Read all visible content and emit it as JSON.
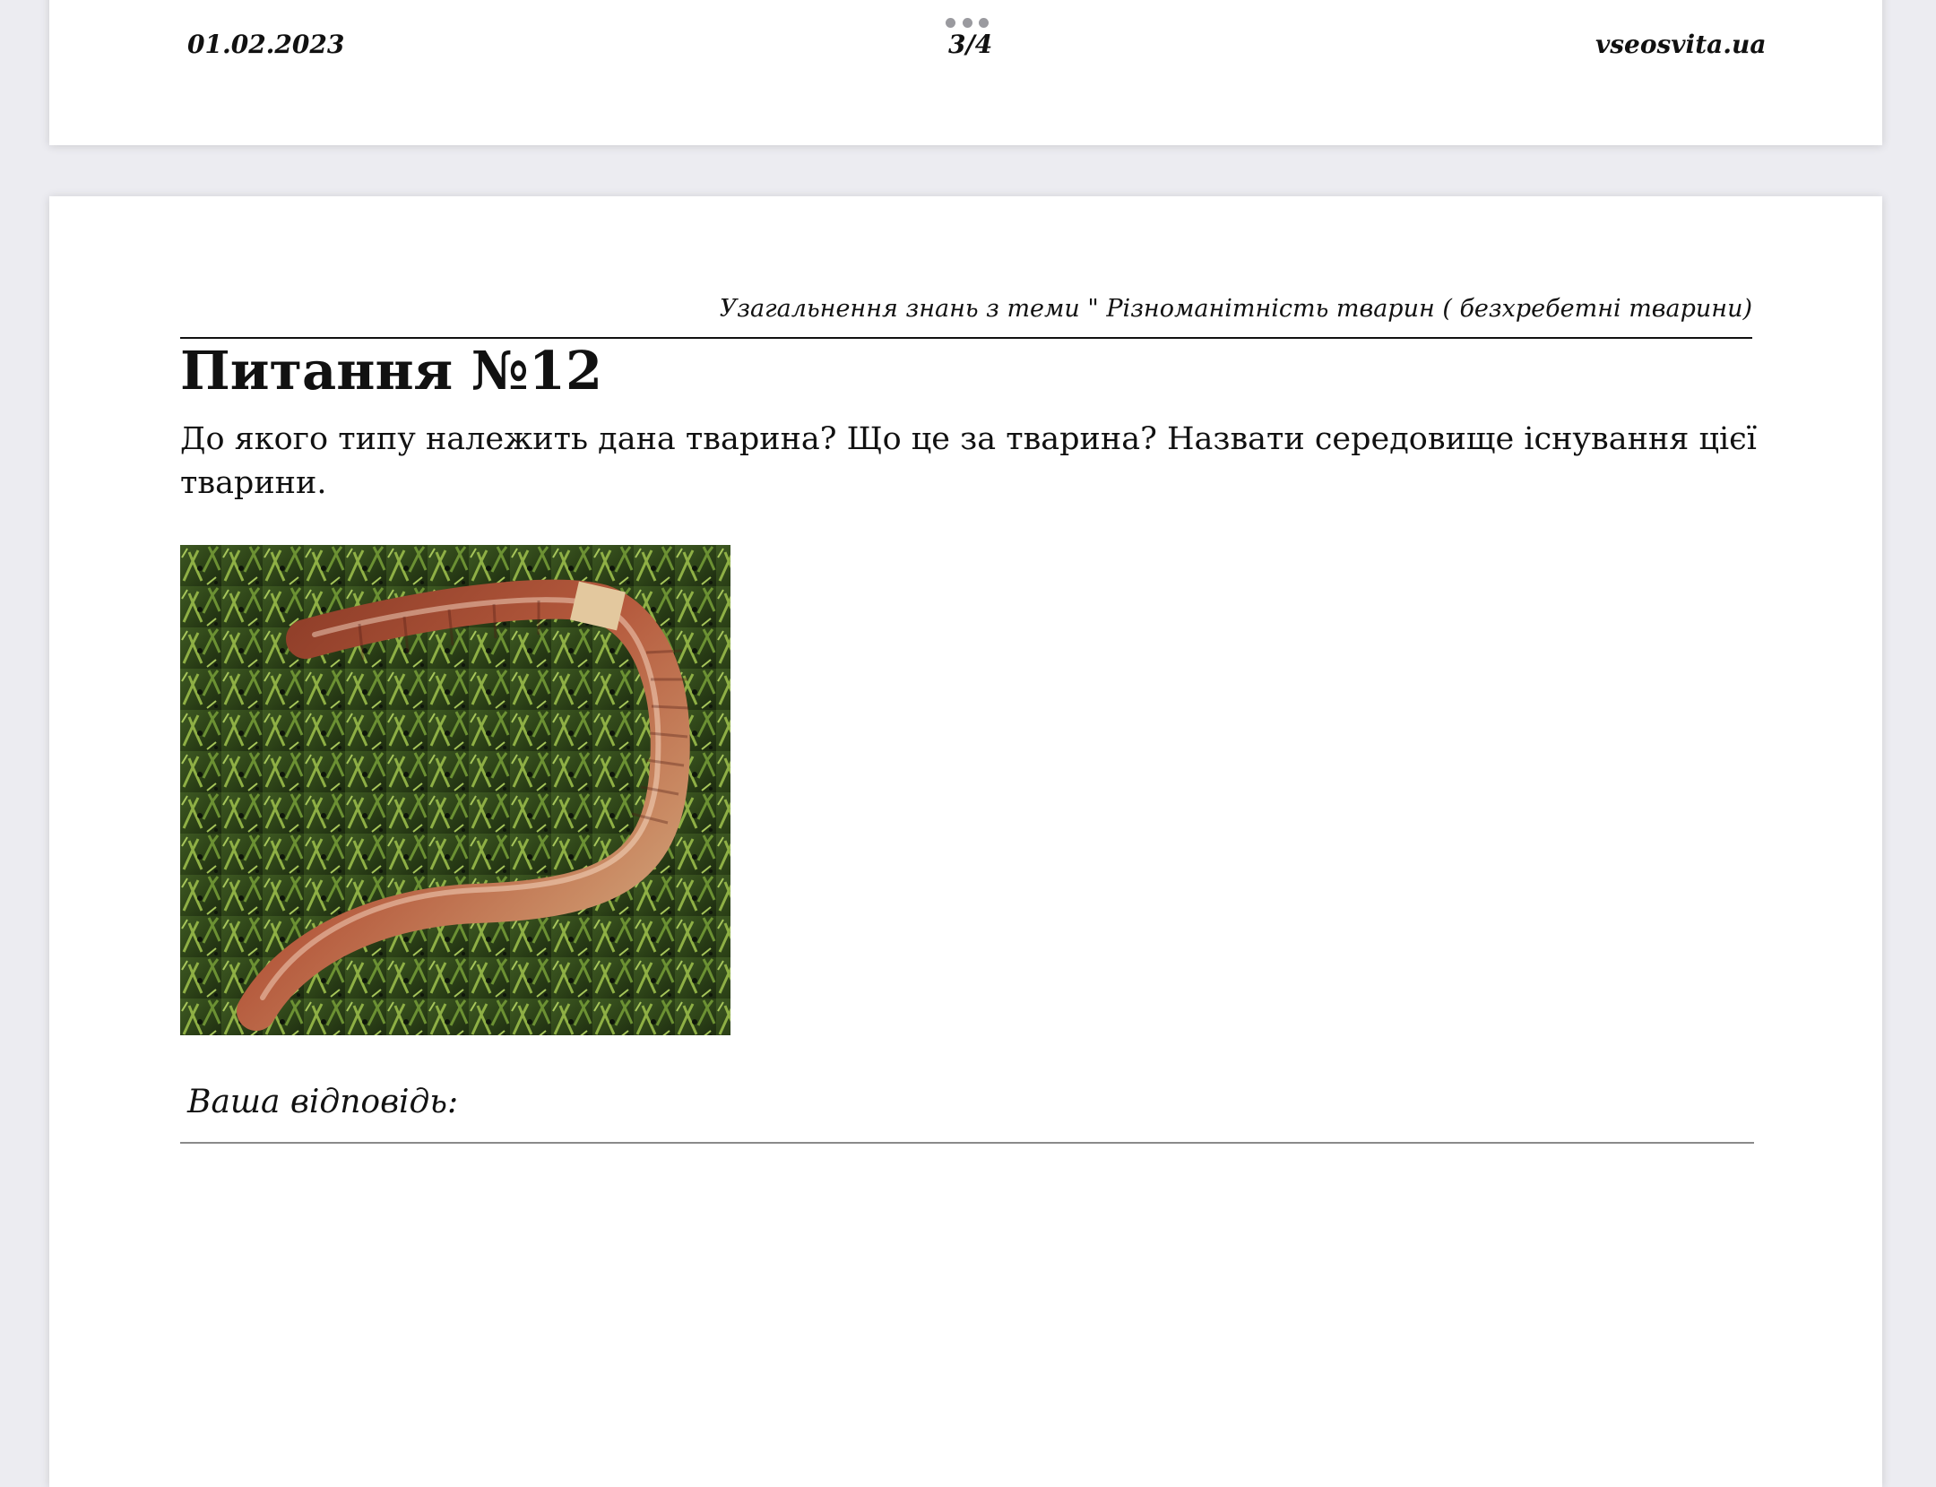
{
  "previous_page": {
    "footer": {
      "date": "01.02.2023",
      "page_number": "3/4",
      "site": "vseosvita.ua"
    }
  },
  "current_page": {
    "running_header": "Узагальнення знань з теми \" Різноманітність тварин ( безхребетні тварини)",
    "question": {
      "title": "Питання №12",
      "text": "До якого типу належить дана тварина? Що це за тварина? Назвати середовище існування цієї тварини.",
      "image_subject": "earthworm on green moss"
    },
    "answer_label": "Ваша відповідь:"
  },
  "icons": {
    "more_menu": "more-dots-icon"
  },
  "colors": {
    "background": "#ececf1",
    "page": "#ffffff",
    "text": "#111111"
  }
}
